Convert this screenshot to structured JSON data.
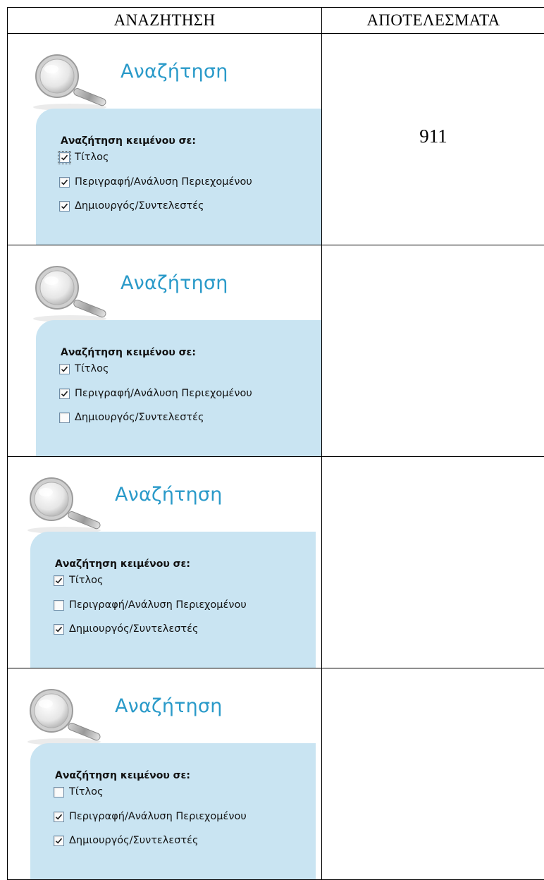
{
  "table": {
    "headers": {
      "search": "ΑΝΑΖΗΤΗΣΗ",
      "results": "ΑΠΟΤΕΛΕΣΜΑΤΑ"
    },
    "rows": [
      {
        "heading": "Αναζήτηση",
        "panel_title": "Αναζήτηση κειμένου σε:",
        "options": [
          {
            "label": "Τίτλος",
            "checked": true,
            "focused": true
          },
          {
            "label": "Περιγραφή/Ανάλυση Περιεχομένου",
            "checked": true
          },
          {
            "label": "Δημιουργός/Συντελεστές",
            "checked": true
          }
        ],
        "result": "911"
      },
      {
        "heading": "Αναζήτηση",
        "panel_title": "Αναζήτηση κειμένου σε:",
        "options": [
          {
            "label": "Τίτλος",
            "checked": true
          },
          {
            "label": "Περιγραφή/Ανάλυση Περιεχομένου",
            "checked": true
          },
          {
            "label": "Δημιουργός/Συντελεστές",
            "checked": false
          }
        ],
        "result": ""
      },
      {
        "heading": "Αναζήτηση",
        "panel_title": "Αναζήτηση κειμένου σε:",
        "options": [
          {
            "label": "Τίτλος",
            "checked": true
          },
          {
            "label": "Περιγραφή/Ανάλυση Περιεχομένου",
            "checked": false
          },
          {
            "label": "Δημιουργός/Συντελεστές",
            "checked": true
          }
        ],
        "result": ""
      },
      {
        "heading": "Αναζήτηση",
        "panel_title": "Αναζήτηση κειμένου σε:",
        "options": [
          {
            "label": "Τίτλος",
            "checked": false
          },
          {
            "label": "Περιγραφή/Ανάλυση Περιεχομένου",
            "checked": true
          },
          {
            "label": "Δημιουργός/Συντελεστές",
            "checked": true
          }
        ],
        "result": ""
      }
    ]
  },
  "colors": {
    "heading": "#2a9ac9",
    "panel": "#c9e4f2"
  },
  "icons": {
    "search": "magnifier-icon",
    "check": "checkmark-icon"
  }
}
